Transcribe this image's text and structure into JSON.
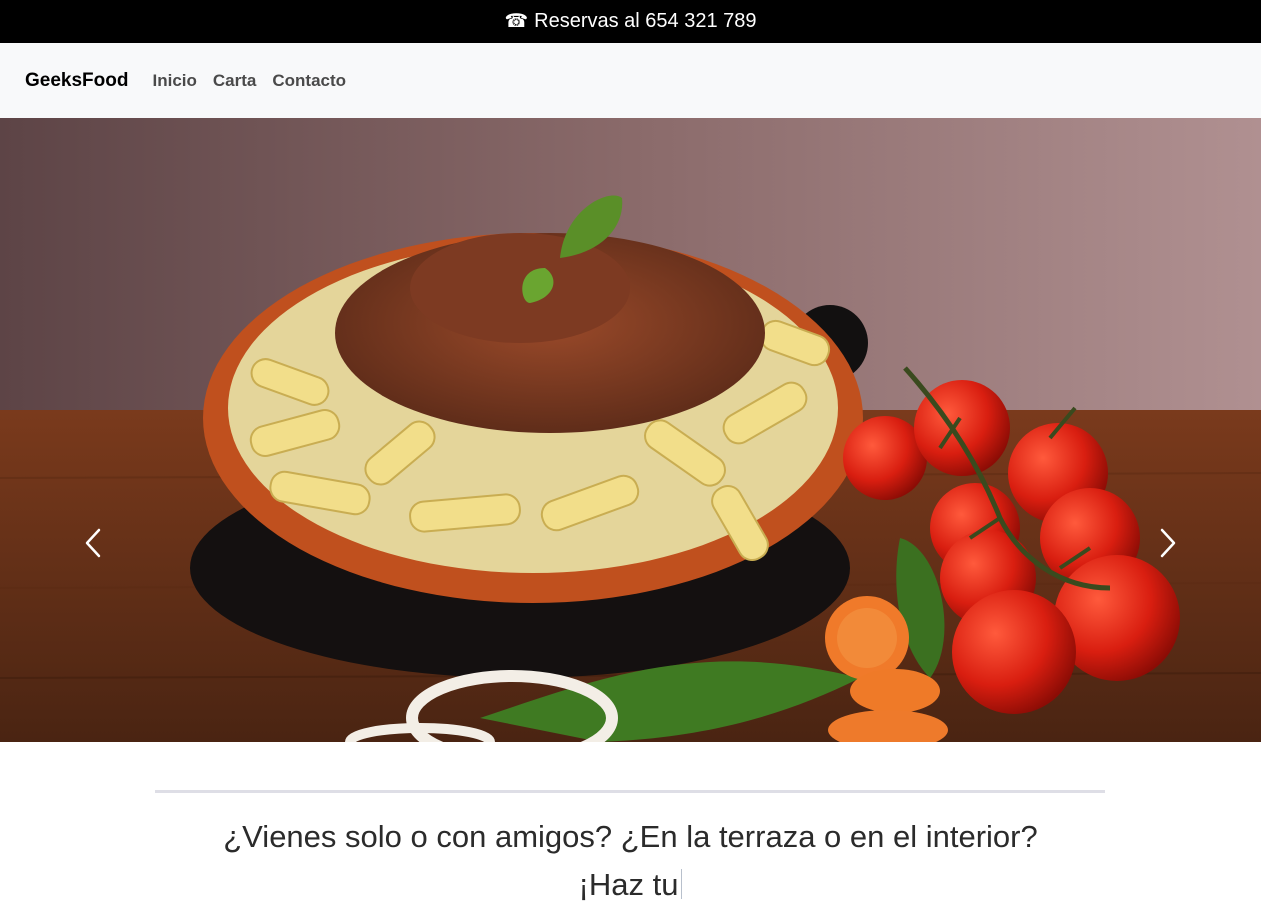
{
  "topbar": {
    "icon": "telephone-icon",
    "text": "Reservas al 654 321 789"
  },
  "navbar": {
    "brand": "GeeksFood",
    "links": [
      "Inicio",
      "Carta",
      "Contacto"
    ]
  },
  "carousel": {
    "image": "pasta-with-bolognese-and-tomatoes",
    "prev_icon": "chevron-left-icon",
    "next_icon": "chevron-right-icon"
  },
  "content": {
    "line1": "¿Vienes solo o con amigos? ¿En la terraza o en el interior?",
    "line2": "¡Haz tu"
  },
  "colors": {
    "topbar_bg": "#000000",
    "navbar_bg": "#f8f9fa",
    "divider": "#dedee6"
  }
}
